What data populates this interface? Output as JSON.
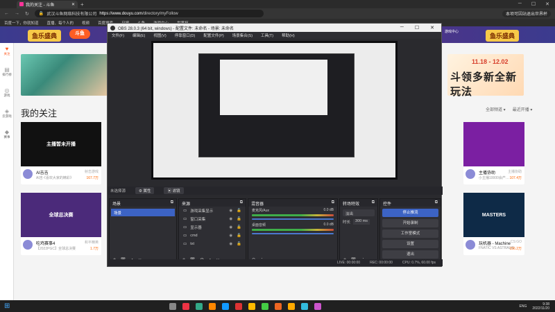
{
  "browser": {
    "tab_title": "我的关注 - 斗鱼",
    "url_prefix": "",
    "url_domain": "https://www.douyu.com",
    "url_path": "/directory/myFollow",
    "cert_owner": "武汉斗鱼网络科技有限公司",
    "right_pill": "本项可因站退出世界杯",
    "bookmarks": [
      "百度一下，你就知道",
      "直播、每个人的",
      "视频",
      "百度搜索",
      "日报",
      "斗鱼",
      "游戏中心",
      "世界杯"
    ]
  },
  "site": {
    "logo_text": "鱼乐盛典",
    "douyu": "斗鱼",
    "top_icons": [
      "游戏中心",
      "下载",
      "开播"
    ],
    "left_nav": [
      {
        "g": "♥",
        "label": "关注"
      },
      {
        "g": "▤",
        "label": "排行榜"
      },
      {
        "g": "◎",
        "label": "游戏"
      },
      {
        "g": "◈",
        "label": "云游戏"
      },
      {
        "g": "◆",
        "label": "赛事"
      }
    ],
    "banner_date": "11.18 - 12.02",
    "banner_big": "斗领多新全新玩法",
    "page_title": "我的关注",
    "sort_options": [
      "全部频道 ▾",
      "最近开播 ▾"
    ]
  },
  "cards": [
    {
      "name": "AI吉吉",
      "sub": "AI吉·《喜欢大家的精彩》",
      "tag": "射击游戏",
      "hot": "167.7万",
      "thumb": "#111",
      "thumb_text": "主播暂未开播"
    },
    {
      "name": "吃鸡赛事4",
      "sub": "【2022PGC】全球总决赛",
      "tag": "和平精英",
      "hot": "1.7万",
      "thumb": "#4b2a7a",
      "thumb_text": "全球总决赛"
    },
    {
      "name": "主播协助",
      "sub": "小主播10000会产…",
      "tag": "主播协助",
      "hot": "107.4万",
      "thumb": "#7b1fa2",
      "thumb_text": ""
    },
    {
      "name": "玩机器 - Machine",
      "sub": "FNATIC VS ASTRALIS",
      "tag": "CS:GO",
      "hot": "156.2万",
      "thumb": "#0e2a47",
      "thumb_text": "MASTERS"
    }
  ],
  "obs": {
    "title": "OBS 28.0.3 (64 bit, windows) - 配置文件: 未命名 - 场景: 未命名",
    "menu": [
      "文件(F)",
      "编辑(E)",
      "视图(V)",
      "停靠窗口(D)",
      "配置文件(P)",
      "场景集合(S)",
      "工具(T)",
      "帮助(H)"
    ],
    "source_bar": {
      "label": "未选择源",
      "props": "⚙ 属性",
      "filters": "▣ 滤镜"
    },
    "docks": {
      "scenes": {
        "title": "场景",
        "items": [
          "场景"
        ]
      },
      "sources": {
        "title": "来源",
        "items": [
          "游戏采集显示",
          "窗口采集",
          "显示器",
          "cmd",
          "txt"
        ]
      },
      "mixer": {
        "title": "混音器",
        "rows": [
          {
            "name": "麦克风/Aux",
            "db": "0.0 dB"
          },
          {
            "name": "桌面音频",
            "db": "0.0 dB"
          }
        ]
      },
      "transitions": {
        "title": "转场特效",
        "type": "淡出",
        "duration_label": "时长",
        "duration": "300 ms"
      },
      "controls": {
        "title": "控件",
        "buttons": [
          "停止推流",
          "开始录制",
          "工作室模式",
          "设置",
          "退出"
        ]
      }
    },
    "status": {
      "live": "LIVE: 00:00:00",
      "rec": "REC: 00:00:00",
      "cpu": "CPU: 0.7%, 60.00 fps"
    }
  },
  "taskbar": {
    "lang": "ENG",
    "time": "9:38",
    "date": "2022/11/20",
    "icon_colors": [
      "#888",
      "#e34",
      "#3a8",
      "#f80",
      "#19f",
      "#d33",
      "#fb0",
      "#4c4",
      "#e62",
      "#fa0",
      "#3bd",
      "#c5c"
    ]
  }
}
